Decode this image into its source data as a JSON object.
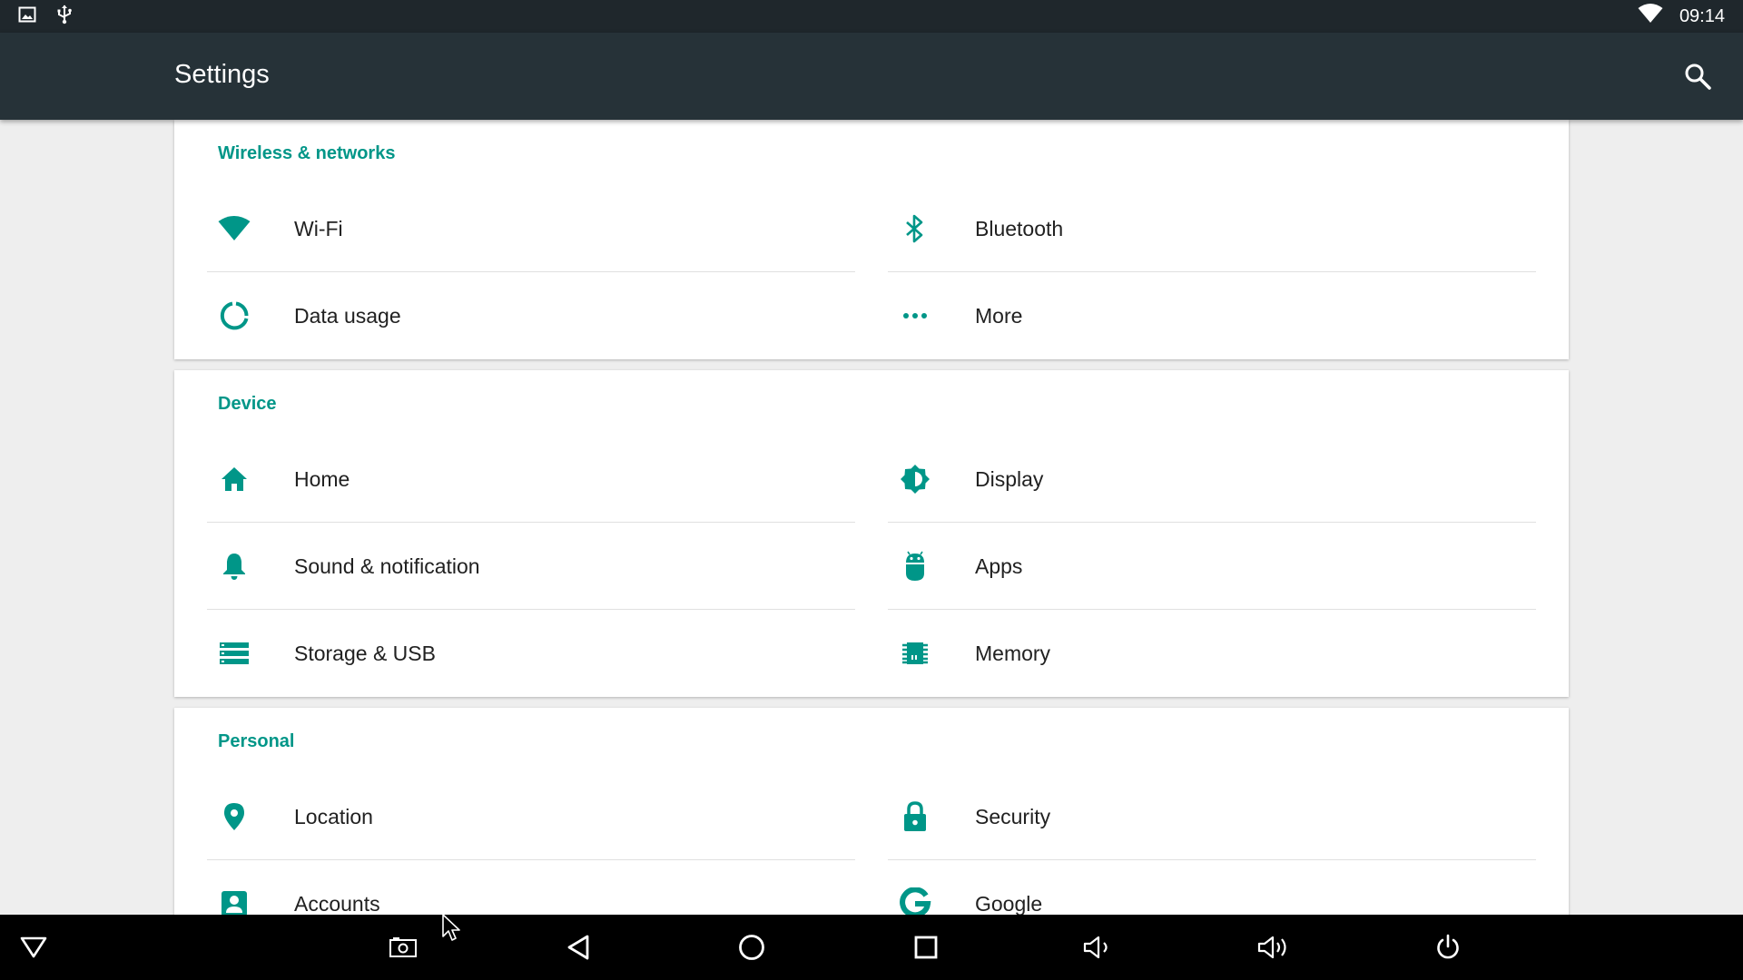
{
  "status_bar": {
    "time": "09:14",
    "icons": [
      "image-icon",
      "usb-icon",
      "wifi-signal-icon"
    ]
  },
  "app_bar": {
    "title": "Settings",
    "search_icon": "search-icon"
  },
  "accent_color": "#009688",
  "sections": [
    {
      "title": "Wireless & networks",
      "items": [
        {
          "label": "Wi-Fi",
          "icon": "wifi-icon"
        },
        {
          "label": "Bluetooth",
          "icon": "bluetooth-icon"
        },
        {
          "label": "Data usage",
          "icon": "data-usage-icon"
        },
        {
          "label": "More",
          "icon": "more-dots-icon"
        }
      ]
    },
    {
      "title": "Device",
      "items": [
        {
          "label": "Home",
          "icon": "home-icon"
        },
        {
          "label": "Display",
          "icon": "brightness-icon"
        },
        {
          "label": "Sound & notification",
          "icon": "bell-icon"
        },
        {
          "label": "Apps",
          "icon": "android-icon"
        },
        {
          "label": "Storage & USB",
          "icon": "storage-icon"
        },
        {
          "label": "Memory",
          "icon": "memory-chip-icon"
        }
      ]
    },
    {
      "title": "Personal",
      "items": [
        {
          "label": "Location",
          "icon": "location-pin-icon"
        },
        {
          "label": "Security",
          "icon": "lock-icon"
        },
        {
          "label": "Accounts",
          "icon": "account-icon"
        },
        {
          "label": "Google",
          "icon": "google-icon"
        }
      ]
    }
  ],
  "nav_bar": [
    "notification-shade-icon",
    "screenshot-icon",
    "back-icon",
    "home-circle-icon",
    "recents-icon",
    "volume-down-icon",
    "volume-up-icon",
    "power-icon"
  ]
}
